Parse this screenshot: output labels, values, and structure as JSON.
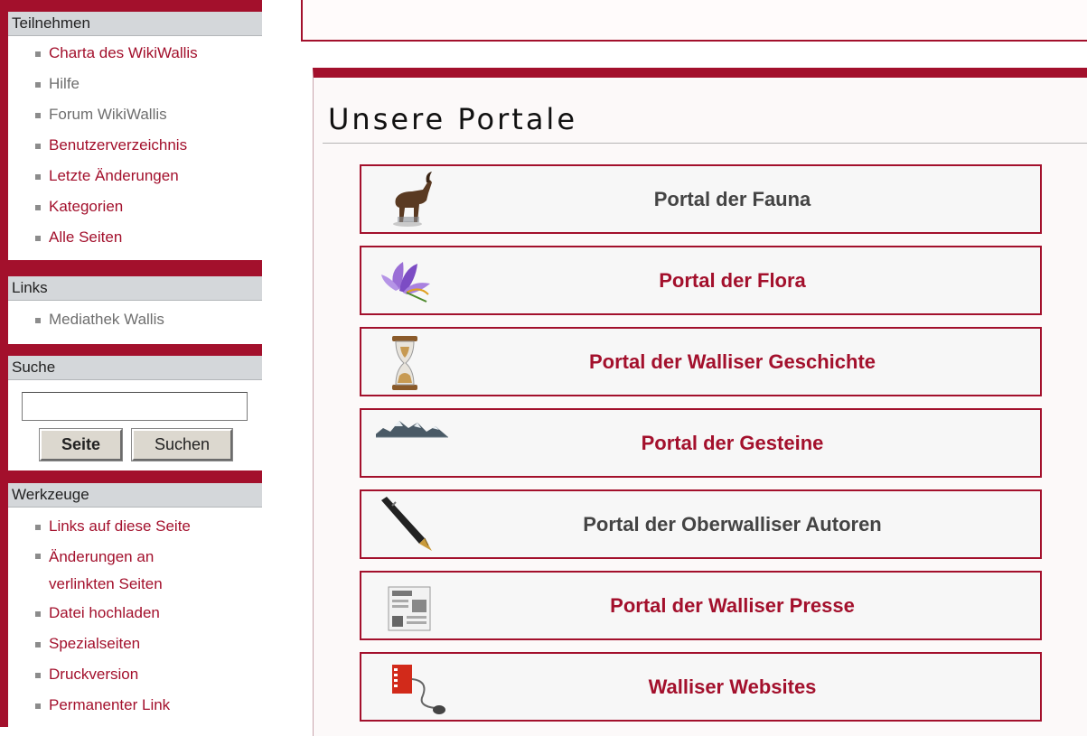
{
  "sidebar": {
    "teilnehmen": {
      "title": "Teilnehmen",
      "items": [
        {
          "label": "Charta des WikiWallis"
        },
        {
          "label": "Hilfe"
        },
        {
          "label": "Forum WikiWallis"
        },
        {
          "label": "Benutzerverzeichnis"
        },
        {
          "label": "Letzte Änderungen"
        },
        {
          "label": "Kategorien"
        },
        {
          "label": "Alle Seiten"
        }
      ]
    },
    "links": {
      "title": "Links",
      "items": [
        {
          "label": "Mediathek Wallis"
        }
      ]
    },
    "suche": {
      "title": "Suche",
      "input_value": "",
      "go_label": "Seite",
      "search_label": "Suchen"
    },
    "werkzeuge": {
      "title": "Werkzeuge",
      "items": [
        {
          "label": "Links auf diese Seite"
        },
        {
          "label": "Änderungen an"
        },
        {
          "label": "verlinkten Seiten"
        },
        {
          "label": "Datei hochladen"
        },
        {
          "label": "Spezialseiten"
        },
        {
          "label": "Druckversion"
        },
        {
          "label": "Permanenter Link"
        }
      ]
    }
  },
  "main": {
    "title": "Unsere Portale",
    "portals": [
      {
        "label": "Portal der Fauna",
        "icon": "ibex-icon"
      },
      {
        "label": "Portal der Flora",
        "icon": "crocus-flower-icon"
      },
      {
        "label": "Portal der Walliser Geschichte",
        "icon": "hourglass-icon"
      },
      {
        "label": "Portal der Gesteine",
        "icon": "mountains-icon"
      },
      {
        "label": "Portal der Oberwalliser Autoren",
        "icon": "fountain-pen-icon"
      },
      {
        "label": "Portal der Walliser Presse",
        "icon": "newspaper-icon"
      },
      {
        "label": "Walliser Websites",
        "icon": "network-cable-icon"
      }
    ]
  },
  "colors": {
    "accent": "#a3102c",
    "link": "#a3102c",
    "visited_link": "#6e6e6e",
    "portlet_header": "#d4d7da"
  }
}
